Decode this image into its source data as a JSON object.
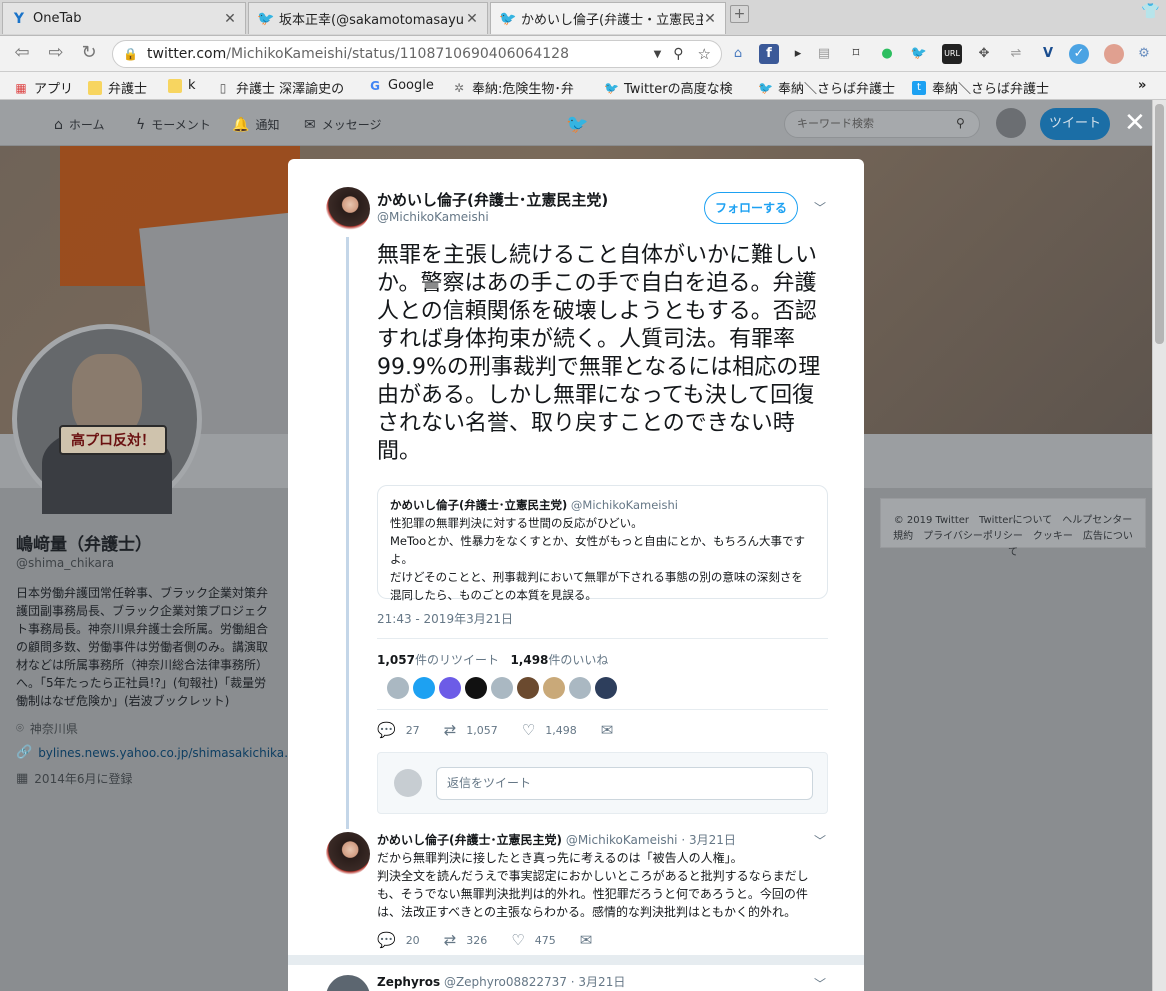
{
  "browser": {
    "tabs": [
      {
        "title": "OneTab"
      },
      {
        "title": "坂本正幸(@sakamotomasayu"
      },
      {
        "title": "かめいし倫子(弁護士・立憲民主"
      }
    ],
    "new_tab_glyph": "+",
    "url_domain": "twitter.com",
    "url_path": "/MichikoKameishi/status/1108710690406064128",
    "bookmarks": [
      {
        "label": "アプリ"
      },
      {
        "label": "弁護士"
      },
      {
        "label": "k"
      },
      {
        "label": "弁護士 深澤諭史の"
      },
      {
        "label": "Google"
      },
      {
        "label": "奉納:危険生物･弁"
      },
      {
        "label": "Twitterの高度な検"
      },
      {
        "label": "奉納＼さらば弁護士"
      },
      {
        "label": "奉納＼さらば弁護士"
      }
    ],
    "bookmark_overflow": "»"
  },
  "twitter_nav": {
    "home": "ホーム",
    "moments": "モーメント",
    "notifications": "通知",
    "messages": "メッセージ",
    "search_placeholder": "キーワード検索",
    "tweet_button": "ツイート",
    "close": "✕"
  },
  "profile": {
    "avatar_sign": "高プロ反対！",
    "name": "嶋﨑量（弁護士）",
    "handle": "@shima_chikara",
    "bio": "日本労働弁護団常任幹事、ブラック企業対策弁護団副事務局長、ブラック企業対策プロジェクト事務局長。神奈川県弁護士会所属。労働組合の顧問多数、労働事件は労働者側のみ。講演取材などは所属事務所（神奈川総合法律事務所）へ。「5年たったら正社員!?」(旬報社)「裁量労働制はなぜ危険か」(岩波ブックレット)",
    "location": "神奈川県",
    "link": "bylines.news.yahoo.co.jp/shimasakichika…",
    "joined": "2014年6月に登録"
  },
  "sidebar_footer": {
    "line1": "© 2019 Twitter　Twitterについて　ヘルプセンター",
    "line2": "規約　プライバシーポリシー　クッキー　広告について"
  },
  "tweet": {
    "author_name": "かめいし倫子(弁護士･立憲民主党)",
    "author_handle": "@MichikoKameishi",
    "follow_label": "フォローする",
    "text": "無罪を主張し続けること自体がいかに難しいか。警察はあの手この手で自白を迫る。弁護人との信頼関係を破壊しようともする。否認すれば身体拘束が続く。人質司法。有罪率99.9%の刑事裁判で無罪となるには相応の理由がある。しかし無罪になっても決して回復されない名誉、取り戻すことのできない時間。",
    "quote": {
      "name": "かめいし倫子(弁護士･立憲民主党)",
      "handle": "@MichikoKameishi",
      "line1": "性犯罪の無罪判決に対する世間の反応がひどい。",
      "line2": "MeTooとか、性暴力をなくすとか、女性がもっと自由にとか、もちろん大事ですよ。",
      "line3": "だけどそのことと、刑事裁判において無罪が下される事態の別の意味の深刻さを",
      "line4": "混同したら、ものごとの本質を見誤る。"
    },
    "time": "21:43 - 2019年3月21日",
    "retweet_count": "1,057",
    "retweet_label": "件のリツイート",
    "like_count": "1,498",
    "like_label": "件のいいね",
    "liker_colors": [
      "#aab8c2",
      "#1da1f2",
      "#6c5ce7",
      "#111111",
      "#aab8c2",
      "#6b4a2f",
      "#c9a979",
      "#aab8c2",
      "#2d3e5c"
    ],
    "actions": {
      "replies": "27",
      "retweets": "1,057",
      "likes": "1,498"
    },
    "reply_placeholder": "返信をツイート"
  },
  "reply_tweet": {
    "name": "かめいし倫子(弁護士･立憲民主党)",
    "handle": "@MichikoKameishi",
    "date": "· 3月21日",
    "line1": "だから無罪判決に接したとき真っ先に考えるのは「被告人の人権」。",
    "line2": "判決全文を読んだうえで事実認定におかしいところがあると批判するならまだしも、そうでない無罪判決批判は的外れ。性犯罪だろうと何であろうと。今回の件は、法改正すべきとの主張ならわかる。感情的な判決批判はともかく的外れ。",
    "actions": {
      "replies": "20",
      "retweets": "326",
      "likes": "475"
    }
  },
  "next_tweet": {
    "name": "Zephyros",
    "handle": "@Zephyro08822737",
    "date": "· 3月21日"
  }
}
